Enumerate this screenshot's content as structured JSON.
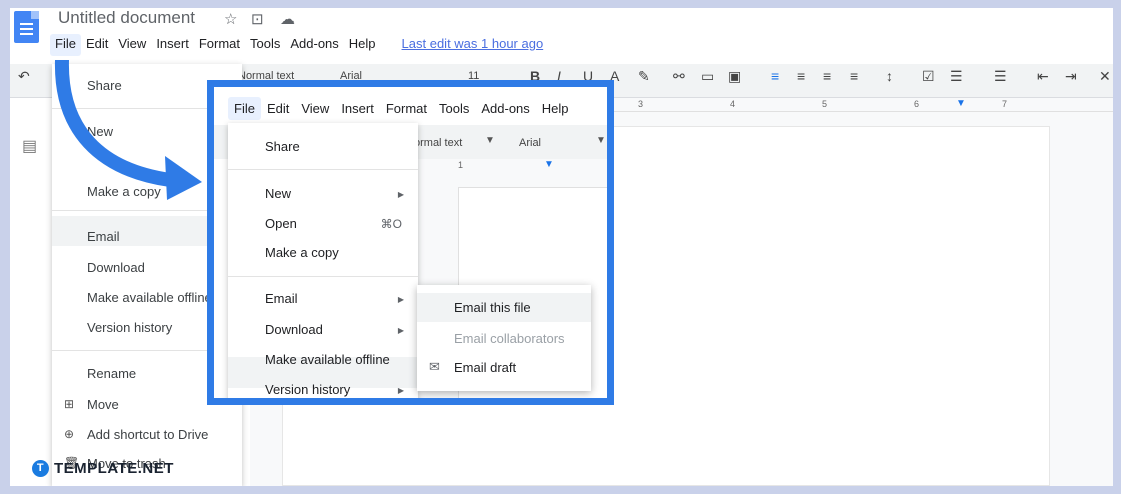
{
  "doc": {
    "title": "Untitled document",
    "star_icon": "star-icon",
    "folder_icon": "move-folder-icon",
    "cloud_icon": "cloud-status-icon"
  },
  "menubar": {
    "items": [
      "File",
      "Edit",
      "View",
      "Insert",
      "Format",
      "Tools",
      "Add-ons",
      "Help"
    ],
    "last_edit": "Last edit was 1 hour ago"
  },
  "toolbar": {
    "style": "Normal text",
    "font": "Arial",
    "font_size": "11"
  },
  "ruler": {
    "ticks": [
      "3",
      "4",
      "5",
      "6",
      "7"
    ]
  },
  "bg_menu": {
    "items": [
      "Share",
      "New",
      "Make a copy",
      "Email",
      "Download",
      "Make available offline",
      "Version history",
      "Rename",
      "Move",
      "Add shortcut to Drive",
      "Move to trash"
    ]
  },
  "zoom_menubar": {
    "items": [
      "File",
      "Edit",
      "View",
      "Insert",
      "Format",
      "Tools",
      "Add-ons",
      "Help"
    ]
  },
  "zoom_toolbar": {
    "style": "ormal text",
    "font": "Arial"
  },
  "zoom_ruler": {
    "tick": "1"
  },
  "zoom_menu": {
    "share": "Share",
    "new": "New",
    "open": "Open",
    "open_shortcut": "⌘O",
    "copy": "Make a copy",
    "email": "Email",
    "download": "Download",
    "offline": "Make available offline",
    "version": "Version history"
  },
  "email_submenu": {
    "email_file": "Email this file",
    "email_collaborators": "Email collaborators",
    "email_draft": "Email draft"
  },
  "brand": {
    "name": "TEMPLATE.NET",
    "mark": "T"
  },
  "colors": {
    "accent": "#2f7be6",
    "brand": "#1a7be0",
    "link": "#4a6ee0",
    "highlight": "#f1f3f4"
  }
}
